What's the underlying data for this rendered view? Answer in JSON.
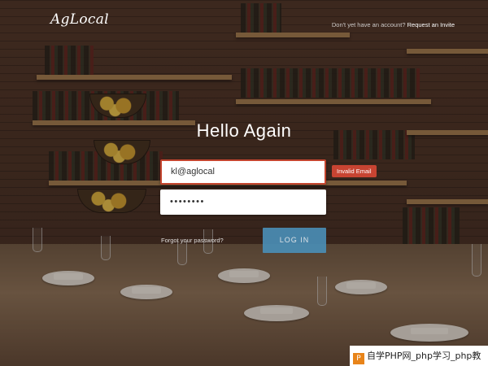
{
  "brand": {
    "logo_text": "AgLocal"
  },
  "header": {
    "signup_prompt": "Don't yet have an account?",
    "signup_link": "Request an Invite"
  },
  "form": {
    "title": "Hello Again",
    "email_value": "kl@aglocal",
    "password_value": "••••••••",
    "email_error": "Invalid Email",
    "forgot_label": "Forgot your password?",
    "login_label": "LOG IN"
  },
  "watermark": {
    "text": "自学PHP网_php学习_php教",
    "logo_glyph": "P"
  },
  "colors": {
    "error": "#c84432",
    "button": "#4a8db5",
    "text": "#ffffff"
  }
}
